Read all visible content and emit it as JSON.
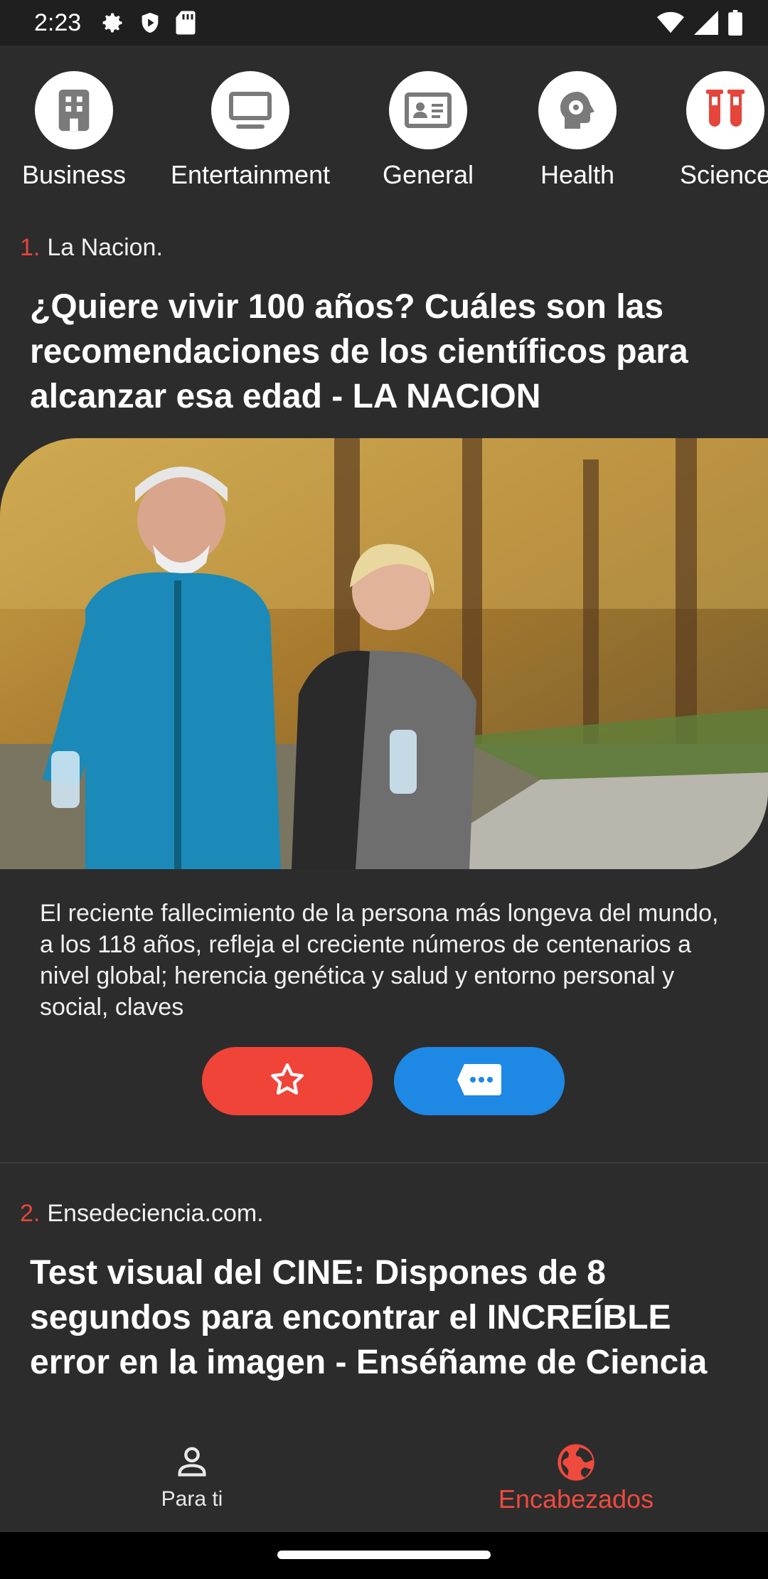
{
  "status_bar": {
    "time": "2:23"
  },
  "categories": [
    {
      "label": "Business",
      "icon": "building-icon"
    },
    {
      "label": "Entertainment",
      "icon": "monitor-icon"
    },
    {
      "label": "General",
      "icon": "id-card-icon"
    },
    {
      "label": "Health",
      "icon": "head-gear-icon"
    },
    {
      "label": "Science",
      "icon": "test-tubes-icon"
    }
  ],
  "articles": [
    {
      "number": "1.",
      "source": "La Nacion.",
      "title": "¿Quiere vivir 100 años? Cuáles son las recomendaciones de los científicos para alcanzar esa edad - LA NACION",
      "description": "El reciente fallecimiento de la persona más longeva del mundo, a los 118 años, refleja el creciente números de centenarios a nivel global; herencia genética y  salud y entorno personal y social, claves"
    },
    {
      "number": "2.",
      "source": "Ensedeciencia.com.",
      "title": "Test visual del CINE: Dispones de 8 segundos para encontrar el INCREÍBLE error en la imagen - Enséñame de Ciencia"
    }
  ],
  "bottom_nav": [
    {
      "label": "Para ti",
      "icon": "person-icon",
      "active": false
    },
    {
      "label": "Encabezados",
      "icon": "globe-icon",
      "active": true
    }
  ],
  "colors": {
    "background": "#2c2c2c",
    "accent_red": "#f04438",
    "accent_blue": "#1e88e5",
    "active_nav": "#ef4a3e"
  }
}
